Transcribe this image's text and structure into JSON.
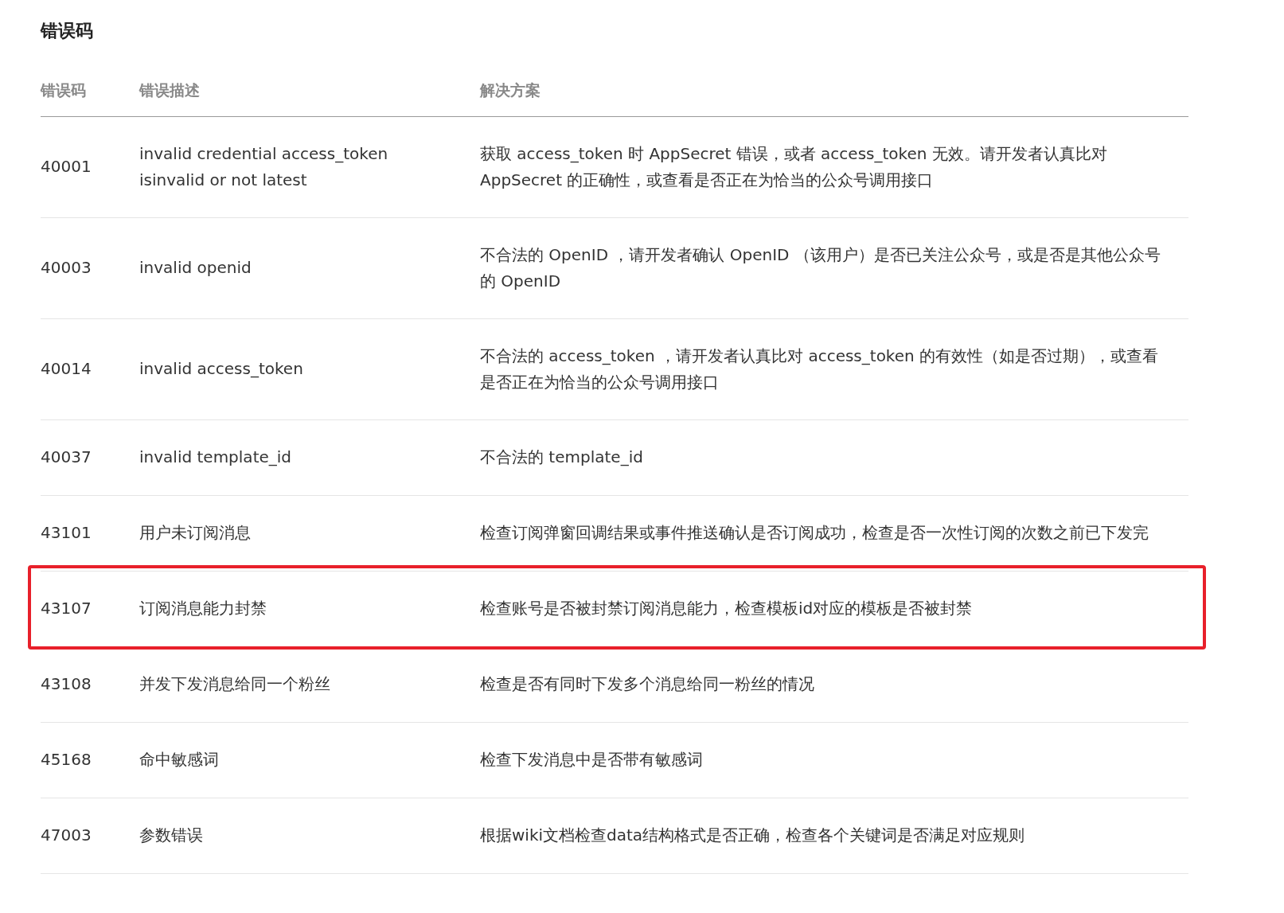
{
  "title": "错误码",
  "table": {
    "columns": [
      "错误码",
      "错误描述",
      "解决方案"
    ],
    "rows": [
      {
        "code": "40001",
        "description": "invalid credential  access_token isinvalid or not latest",
        "solution": "获取 access_token 时 AppSecret 错误，或者 access_token 无效。请开发者认真比对 AppSecret 的正确性，或查看是否正在为恰当的公众号调用接口",
        "highlighted": false
      },
      {
        "code": "40003",
        "description": "invalid openid",
        "solution": "不合法的 OpenID ，请开发者确认 OpenID （该用户）是否已关注公众号，或是否是其他公众号的 OpenID",
        "highlighted": false
      },
      {
        "code": "40014",
        "description": "invalid access_token",
        "solution": "不合法的 access_token ，请开发者认真比对 access_token 的有效性（如是否过期），或查看是否正在为恰当的公众号调用接口",
        "highlighted": false
      },
      {
        "code": "40037",
        "description": "invalid template_id",
        "solution": "不合法的 template_id",
        "highlighted": false
      },
      {
        "code": "43101",
        "description": "用户未订阅消息",
        "solution": "检查订阅弹窗回调结果或事件推送确认是否订阅成功，检查是否一次性订阅的次数之前已下发完",
        "highlighted": false
      },
      {
        "code": "43107",
        "description": "订阅消息能力封禁",
        "solution": "检查账号是否被封禁订阅消息能力，检查模板id对应的模板是否被封禁",
        "highlighted": true
      },
      {
        "code": "43108",
        "description": "并发下发消息给同一个粉丝",
        "solution": "检查是否有同时下发多个消息给同一粉丝的情况",
        "highlighted": false
      },
      {
        "code": "45168",
        "description": "命中敏感词",
        "solution": "检查下发消息中是否带有敏感词",
        "highlighted": false
      },
      {
        "code": "47003",
        "description": "参数错误",
        "solution": "根据wiki文档检查data结构格式是否正确，检查各个关键词是否满足对应规则",
        "highlighted": false
      }
    ]
  }
}
